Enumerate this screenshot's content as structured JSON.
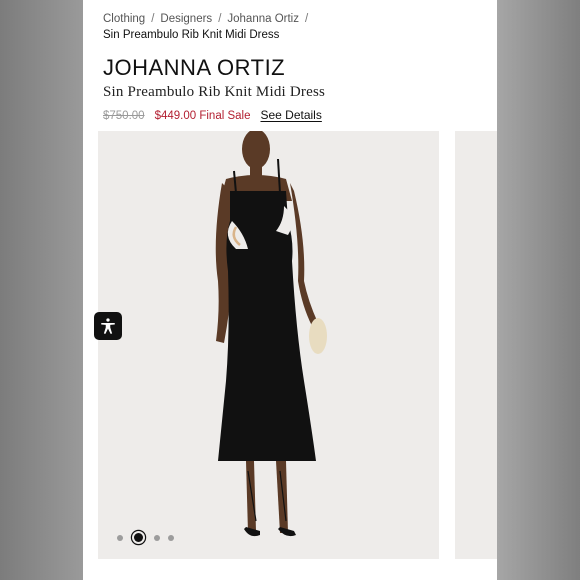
{
  "breadcrumb": {
    "items": [
      "Clothing",
      "Designers",
      "Johanna Ortiz"
    ],
    "separator": "/",
    "current": "Sin Preambulo Rib Knit Midi Dress"
  },
  "product": {
    "brand": "JOHANNA ORTIZ",
    "name": "Sin Preambulo Rib Knit Midi Dress",
    "original_price": "$750.00",
    "sale_price": "$449.00 Final Sale",
    "details_link": "See Details"
  },
  "gallery": {
    "image_count": 4,
    "active_index": 1
  },
  "accessibility": {
    "icon": "accessibility-icon"
  },
  "colors": {
    "sale": "#b32032",
    "dress": "#111111",
    "image_bg": "#eeecea"
  }
}
